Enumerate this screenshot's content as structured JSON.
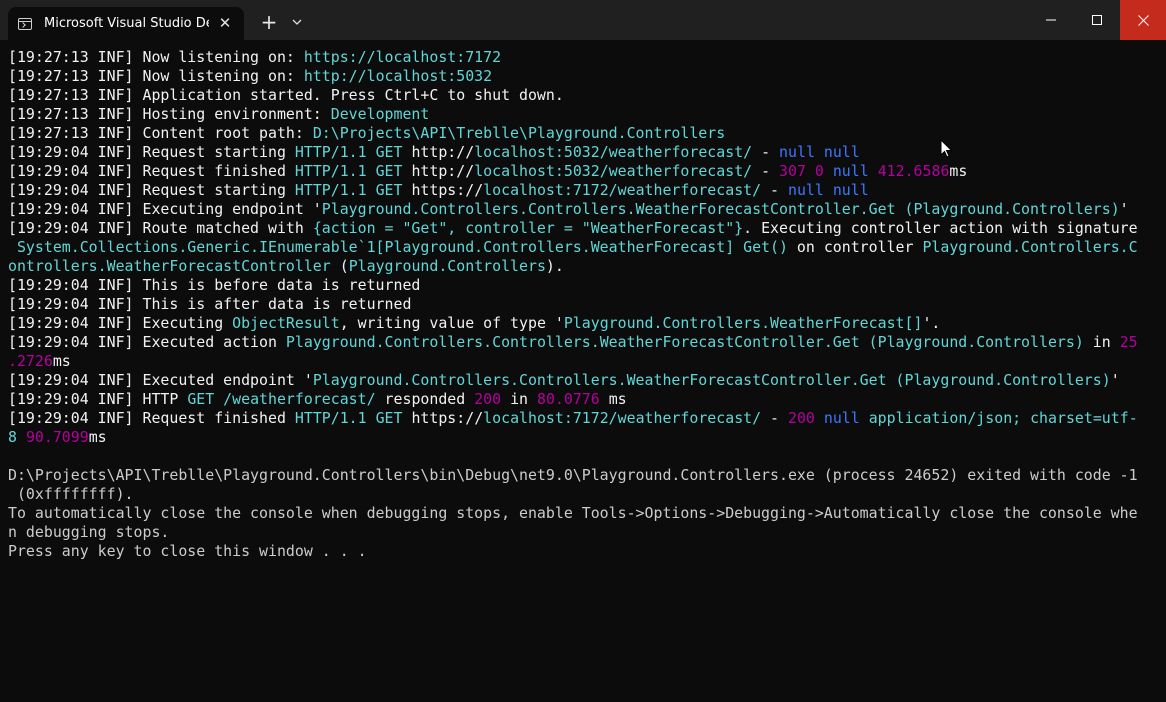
{
  "window": {
    "tab_title": "Microsoft Visual Studio Debug Console",
    "close_tab": "✕",
    "new_tab": "+"
  },
  "console_lines": [
    [
      {
        "t": "[19:27:13 INF] Now listening on: ",
        "c": "white"
      },
      {
        "t": "https://localhost:7172",
        "c": "cyan"
      }
    ],
    [
      {
        "t": "[19:27:13 INF] Now listening on: ",
        "c": "white"
      },
      {
        "t": "http://localhost:5032",
        "c": "cyan"
      }
    ],
    [
      {
        "t": "[19:27:13 INF] Application started. Press Ctrl+C to shut down.",
        "c": "white"
      }
    ],
    [
      {
        "t": "[19:27:13 INF] Hosting environment: ",
        "c": "white"
      },
      {
        "t": "Development",
        "c": "cyan"
      }
    ],
    [
      {
        "t": "[19:27:13 INF] Content root path: ",
        "c": "white"
      },
      {
        "t": "D:\\Projects\\API\\Treblle\\Playground.Controllers",
        "c": "cyan"
      }
    ],
    [
      {
        "t": "[19:29:04 INF] Request starting ",
        "c": "white"
      },
      {
        "t": "HTTP/1.1 GET",
        "c": "cyan"
      },
      {
        "t": " http://",
        "c": "white"
      },
      {
        "t": "localhost:5032/weatherforecast/",
        "c": "cyan"
      },
      {
        "t": " - ",
        "c": "white"
      },
      {
        "t": "null null",
        "c": "blue"
      }
    ],
    [
      {
        "t": "[19:29:04 INF] Request finished ",
        "c": "white"
      },
      {
        "t": "HTTP/1.1 GET",
        "c": "cyan"
      },
      {
        "t": " http://",
        "c": "white"
      },
      {
        "t": "localhost:5032/weatherforecast/",
        "c": "cyan"
      },
      {
        "t": " - ",
        "c": "white"
      },
      {
        "t": "307 0",
        "c": "mag"
      },
      {
        "t": " ",
        "c": "white"
      },
      {
        "t": "null",
        "c": "blue"
      },
      {
        "t": " ",
        "c": "white"
      },
      {
        "t": "412.6586",
        "c": "mag"
      },
      {
        "t": "ms",
        "c": "white"
      }
    ],
    [
      {
        "t": "[19:29:04 INF] Request starting ",
        "c": "white"
      },
      {
        "t": "HTTP/1.1 GET",
        "c": "cyan"
      },
      {
        "t": " https://",
        "c": "white"
      },
      {
        "t": "localhost:7172/weatherforecast/",
        "c": "cyan"
      },
      {
        "t": " - ",
        "c": "white"
      },
      {
        "t": "null null",
        "c": "blue"
      }
    ],
    [
      {
        "t": "[19:29:04 INF] Executing endpoint '",
        "c": "white"
      },
      {
        "t": "Playground.Controllers.Controllers.WeatherForecastController.Get (Playground.Controllers)",
        "c": "cyan"
      },
      {
        "t": "'",
        "c": "white"
      }
    ],
    [
      {
        "t": "[19:29:04 INF] Route matched with ",
        "c": "white"
      },
      {
        "t": "{action = \"Get\", controller = \"WeatherForecast\"}",
        "c": "cyan"
      },
      {
        "t": ". Executing controller action with signature",
        "c": "white"
      }
    ],
    [
      {
        "t": " System.Collections.Generic.IEnumerable`1[Playground.Controllers.WeatherForecast] Get()",
        "c": "cyan"
      },
      {
        "t": " on controller ",
        "c": "white"
      },
      {
        "t": "Playground.Controllers.C",
        "c": "cyan"
      }
    ],
    [
      {
        "t": "ontrollers.WeatherForecastController",
        "c": "cyan"
      },
      {
        "t": " (",
        "c": "white"
      },
      {
        "t": "Playground.Controllers",
        "c": "cyan"
      },
      {
        "t": ").",
        "c": "white"
      }
    ],
    [
      {
        "t": "[19:29:04 INF] This is before data is returned",
        "c": "white"
      }
    ],
    [
      {
        "t": "[19:29:04 INF] This is after data is returned",
        "c": "white"
      }
    ],
    [
      {
        "t": "[19:29:04 INF] Executing ",
        "c": "white"
      },
      {
        "t": "ObjectResult",
        "c": "cyan"
      },
      {
        "t": ", writing value of type '",
        "c": "white"
      },
      {
        "t": "Playground.Controllers.WeatherForecast[]",
        "c": "cyan"
      },
      {
        "t": "'.",
        "c": "white"
      }
    ],
    [
      {
        "t": "[19:29:04 INF] Executed action ",
        "c": "white"
      },
      {
        "t": "Playground.Controllers.Controllers.WeatherForecastController.Get (Playground.Controllers)",
        "c": "cyan"
      },
      {
        "t": " in ",
        "c": "white"
      },
      {
        "t": "25",
        "c": "mag"
      }
    ],
    [
      {
        "t": ".2726",
        "c": "mag"
      },
      {
        "t": "ms",
        "c": "white"
      }
    ],
    [
      {
        "t": "[19:29:04 INF] Executed endpoint '",
        "c": "white"
      },
      {
        "t": "Playground.Controllers.Controllers.WeatherForecastController.Get (Playground.Controllers)",
        "c": "cyan"
      },
      {
        "t": "'",
        "c": "white"
      }
    ],
    [
      {
        "t": "[19:29:04 INF] HTTP ",
        "c": "white"
      },
      {
        "t": "GET /weatherforecast/",
        "c": "cyan"
      },
      {
        "t": " responded ",
        "c": "white"
      },
      {
        "t": "200",
        "c": "mag"
      },
      {
        "t": " in ",
        "c": "white"
      },
      {
        "t": "80.0776",
        "c": "mag"
      },
      {
        "t": " ms",
        "c": "white"
      }
    ],
    [
      {
        "t": "[19:29:04 INF] Request finished ",
        "c": "white"
      },
      {
        "t": "HTTP/1.1 GET",
        "c": "cyan"
      },
      {
        "t": " https://",
        "c": "white"
      },
      {
        "t": "localhost:7172/weatherforecast/",
        "c": "cyan"
      },
      {
        "t": " - ",
        "c": "white"
      },
      {
        "t": "200",
        "c": "mag"
      },
      {
        "t": " ",
        "c": "white"
      },
      {
        "t": "null",
        "c": "blue"
      },
      {
        "t": " ",
        "c": "white"
      },
      {
        "t": "application/json; charset=utf-",
        "c": "cyan"
      }
    ],
    [
      {
        "t": "8",
        "c": "cyan"
      },
      {
        "t": " ",
        "c": "white"
      },
      {
        "t": "90.7099",
        "c": "mag"
      },
      {
        "t": "ms",
        "c": "white"
      }
    ],
    [
      {
        "t": "",
        "c": "white"
      }
    ],
    [
      {
        "t": "D:\\Projects\\API\\Treblle\\Playground.Controllers\\bin\\Debug\\net9.0\\Playground.Controllers.exe (process 24652) exited with code -1",
        "c": "default"
      }
    ],
    [
      {
        "t": " (0xffffffff).",
        "c": "default"
      }
    ],
    [
      {
        "t": "To automatically close the console when debugging stops, enable Tools->Options->Debugging->Automatically close the console whe",
        "c": "default"
      }
    ],
    [
      {
        "t": "n debugging stops.",
        "c": "default"
      }
    ],
    [
      {
        "t": "Press any key to close this window . . .",
        "c": "default"
      }
    ]
  ]
}
